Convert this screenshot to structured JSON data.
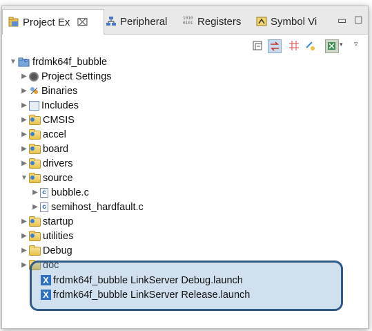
{
  "tabs": [
    {
      "label": "Project Ex",
      "close": "⌧",
      "icon": "project-explorer-icon"
    },
    {
      "label": "Peripheral",
      "icon": "peripheral-icon"
    },
    {
      "label": "Registers",
      "icon": "registers-icon",
      "icon_text": "1010\n0101"
    },
    {
      "label": "Symbol Vi",
      "icon": "symbol-viewer-icon"
    }
  ],
  "window_controls": {
    "minimize": "▭",
    "maximize": "☐"
  },
  "tree": {
    "project": "frdmk64f_bubble",
    "items": [
      {
        "label": "Project Settings",
        "type": "settings",
        "expanded": false
      },
      {
        "label": "Binaries",
        "type": "binaries",
        "expanded": false
      },
      {
        "label": "Includes",
        "type": "includes",
        "expanded": false
      },
      {
        "label": "CMSIS",
        "type": "folder",
        "expanded": false
      },
      {
        "label": "accel",
        "type": "folder",
        "expanded": false
      },
      {
        "label": "board",
        "type": "folder",
        "expanded": false
      },
      {
        "label": "drivers",
        "type": "folder",
        "expanded": false
      },
      {
        "label": "source",
        "type": "folder",
        "expanded": true
      },
      {
        "label": "bubble.c",
        "type": "cfile",
        "child": true
      },
      {
        "label": "semihost_hardfault.c",
        "type": "cfile",
        "child": true
      },
      {
        "label": "startup",
        "type": "folder",
        "expanded": false
      },
      {
        "label": "utilities",
        "type": "folder",
        "expanded": false
      },
      {
        "label": "Debug",
        "type": "folder",
        "expanded": false
      },
      {
        "label": "doc",
        "type": "folder",
        "expanded": false
      },
      {
        "label": "frdmk64f_bubble LinkServer Debug.launch",
        "type": "launch"
      },
      {
        "label": "frdmk64f_bubble LinkServer Release.launch",
        "type": "launch"
      }
    ]
  },
  "colors": {
    "highlight_border": "#2f5a88",
    "launch_icon": "#2f6fc2",
    "folder": "#e8c24a"
  }
}
